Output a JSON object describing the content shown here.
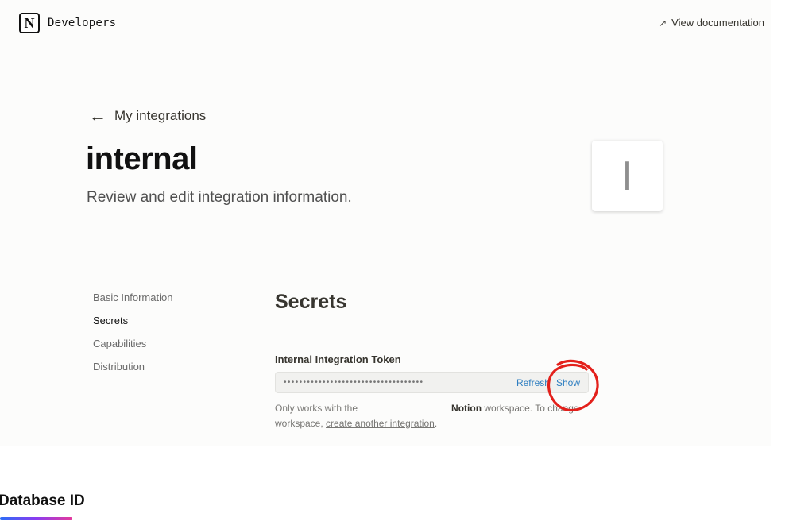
{
  "topbar": {
    "logo_letter": "N",
    "brand": "Developers",
    "doc_arrow": "↗",
    "doc_link": "View documentation"
  },
  "header": {
    "back_arrow": "←",
    "back_label": "My integrations",
    "title": "internal",
    "subtitle": "Review and edit integration information.",
    "icon_letter": "I"
  },
  "sidebar": {
    "items": [
      {
        "label": "Basic Information",
        "active": false
      },
      {
        "label": "Secrets",
        "active": true
      },
      {
        "label": "Capabilities",
        "active": false
      },
      {
        "label": "Distribution",
        "active": false
      }
    ]
  },
  "secrets": {
    "title": "Secrets",
    "token_label": "Internal Integration Token",
    "token_masked": "••••••••••••••••••••••••••••••••••••",
    "refresh_label": "Refresh",
    "show_label": "Show",
    "help_prefix": "Only works with the",
    "help_workspace": "Notion",
    "help_mid": "workspace. To change workspace,",
    "help_link": "create another integration",
    "help_suffix": "."
  },
  "annotation": {
    "color": "#e3201b"
  },
  "below": {
    "heading": "Database ID"
  }
}
